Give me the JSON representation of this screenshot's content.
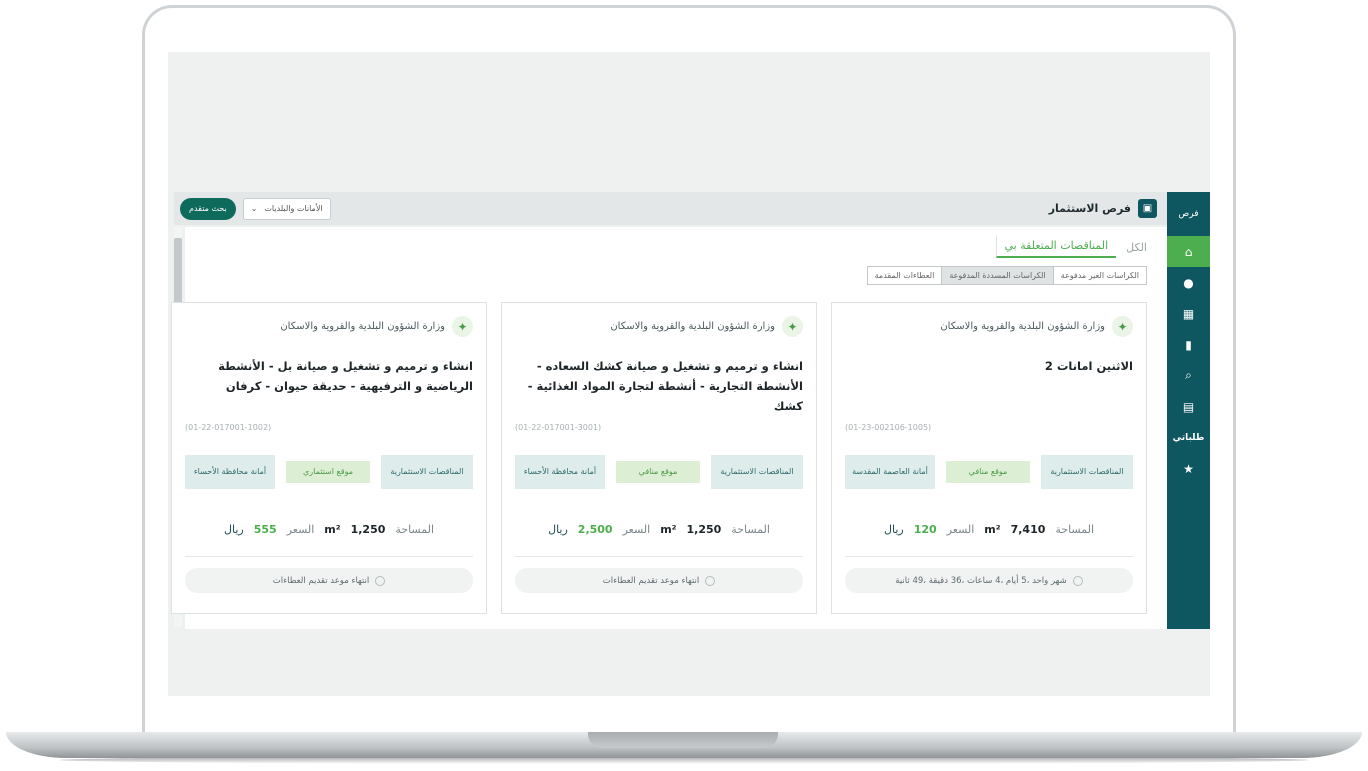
{
  "sidebar": {
    "logo": "فرص",
    "items": [
      {
        "icon": "home-icon",
        "glyph": "⌂",
        "active": true
      },
      {
        "icon": "globe-icon",
        "glyph": "●"
      },
      {
        "icon": "grid-icon",
        "glyph": "▦"
      },
      {
        "icon": "bar-chart-icon",
        "glyph": "▮"
      },
      {
        "icon": "search-icon",
        "glyph": "⌕"
      },
      {
        "icon": "document-icon",
        "glyph": "▤"
      },
      {
        "icon": "text-label",
        "glyph": "طلباتي"
      },
      {
        "icon": "star-icon",
        "glyph": "★"
      }
    ]
  },
  "topbar": {
    "title": "فرص الاستثمار",
    "search_button": "بحث متقدم",
    "dropdown": "الأمانات والبلديات"
  },
  "tabs": [
    {
      "label": "الكل",
      "active": false
    },
    {
      "label": "المناقصات المتعلقة بي",
      "active": true
    }
  ],
  "filters": [
    {
      "label": "الكراسات الغير مدفوعة",
      "selected": false
    },
    {
      "label": "الكراسات المسددة المدفوعة",
      "selected": true
    },
    {
      "label": "العطاءات المقدمة",
      "selected": false
    }
  ],
  "cards": [
    {
      "agency": "وزارة الشؤون البلدية والقروية والاسكان",
      "title": "الاثنين امانات 2",
      "code": "(01-23-002106-1005)",
      "tag_type": "المناقصات الاستثمارية",
      "tag_kind": "موقع منافي",
      "tag_region": "أمانة العاصمة المقدسة",
      "area_label": "المساحة",
      "area": "7,410",
      "area_unit": "m²",
      "price_label": "السعر",
      "price": "120",
      "currency": "ريال",
      "deadline": "شهر واحد ،5 أيام ،4 ساعات ،36 دقيقة ،49 ثانية"
    },
    {
      "agency": "وزارة الشؤون البلدية والقروية والاسكان",
      "title": "انشاء و ترميم و تشغيل و صيانة كشك السعاده - الأنشطة التجارية - أنشطة لتجارة المواد الغذائية - كشك",
      "code": "(01-22-017001-3001)",
      "tag_type": "المناقصات الاستثمارية",
      "tag_kind": "موقع منافي",
      "tag_region": "أمانة محافظة الأحساء",
      "area_label": "المساحة",
      "area": "1,250",
      "area_unit": "m²",
      "price_label": "السعر",
      "price": "2,500",
      "currency": "ريال",
      "deadline": "انتهاء موعد تقديم العطاءات"
    },
    {
      "agency": "وزارة الشؤون البلدية والقروية والاسكان",
      "title": "انشاء و ترميم و تشغيل و صيانة بل - الأنشطة الرياضية و الترفيهية - حديقة حيوان - كرفان",
      "code": "(01-22-017001-1002)",
      "tag_type": "المناقصات الاستثمارية",
      "tag_kind": "موقع استثماري",
      "tag_region": "أمانة محافظة الأحساء",
      "area_label": "المساحة",
      "area": "1,250",
      "area_unit": "m²",
      "price_label": "السعر",
      "price": "555",
      "currency": "ريال",
      "deadline": "انتهاء موعد تقديم العطاءات"
    }
  ]
}
